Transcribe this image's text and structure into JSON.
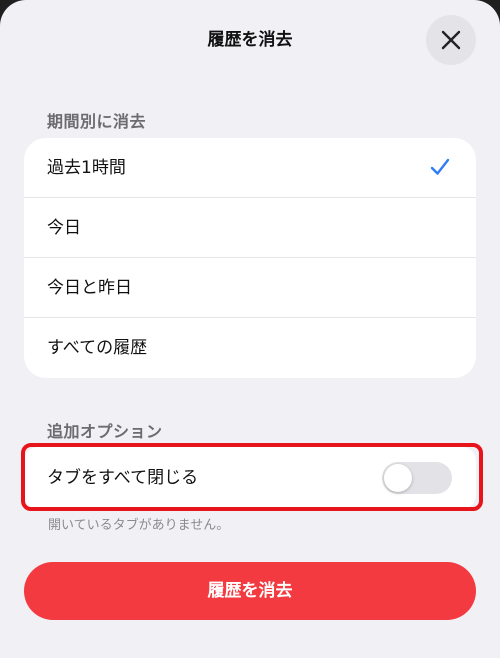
{
  "header": {
    "title": "履歴を消去",
    "close_icon": "close-icon"
  },
  "period_section": {
    "label": "期間別に消去",
    "selected_index": 0,
    "items": [
      {
        "label": "過去1時間",
        "selected": true
      },
      {
        "label": "今日",
        "selected": false
      },
      {
        "label": "今日と昨日",
        "selected": false
      },
      {
        "label": "すべての履歴",
        "selected": false
      }
    ]
  },
  "options_section": {
    "label": "追加オプション",
    "close_tabs": {
      "label": "タブをすべて閉じる",
      "enabled": false
    },
    "hint": "開いているタブがありません。"
  },
  "footer": {
    "clear_button_label": "履歴を消去"
  },
  "colors": {
    "accent": "#2f7df6",
    "danger": "#f23a40",
    "highlight": "#e8141b"
  }
}
